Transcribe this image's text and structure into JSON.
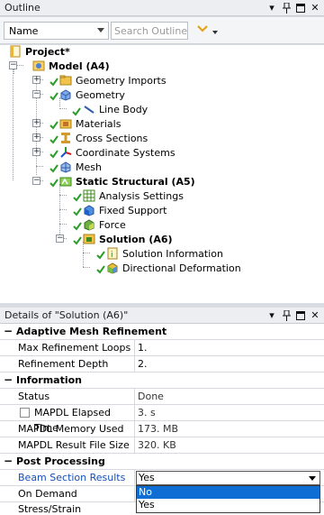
{
  "outline": {
    "title": "Outline",
    "pin": "↓",
    "window_pin": "□",
    "close": "✕",
    "name_combo": "Name",
    "search_placeholder": "Search Outline",
    "tree": {
      "project": "Project*",
      "model": "Model (A4)",
      "geometry_imports": "Geometry Imports",
      "geometry": "Geometry",
      "line_body": "Line Body",
      "materials": "Materials",
      "cross_sections": "Cross Sections",
      "coordinate_systems": "Coordinate Systems",
      "mesh": "Mesh",
      "static_structural": "Static Structural (A5)",
      "analysis_settings": "Analysis Settings",
      "fixed_support": "Fixed Support",
      "force": "Force",
      "solution": "Solution (A6)",
      "solution_information": "Solution Information",
      "directional_deformation": "Directional Deformation"
    }
  },
  "details": {
    "title": "Details of \"Solution (A6)\"",
    "groups": {
      "adaptive": "Adaptive Mesh Refinement",
      "information": "Information",
      "post": "Post Processing"
    },
    "rows": {
      "max_loops_k": "Max Refinement Loops",
      "max_loops_v": "1.",
      "depth_k": "Refinement Depth",
      "depth_v": "2.",
      "status_k": "Status",
      "status_v": "Done",
      "elapsed_k": "MAPDL Elapsed Time",
      "elapsed_v": "3. s",
      "memory_k": "MAPDL Memory Used",
      "memory_v": "173. MB",
      "result_k": "MAPDL Result File Size",
      "result_v": "320. KB",
      "beam_k": "Beam Section Results",
      "beam_v": "Yes",
      "ondemand_k": "On Demand Stress/Strain"
    },
    "dropdown_options": [
      "No",
      "Yes"
    ]
  },
  "colors": {
    "selection": "#0f6ed4",
    "check": "#2a9c2a"
  }
}
